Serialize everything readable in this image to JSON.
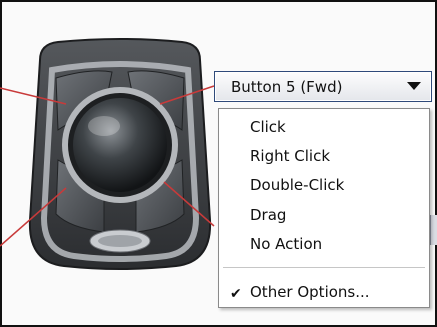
{
  "dropdown": {
    "selected": "Button 5 (Fwd)"
  },
  "menu": {
    "items": [
      "Click",
      "Right Click",
      "Double-Click",
      "Drag",
      "No Action"
    ],
    "other": "Other Options..."
  },
  "colors": {
    "callout_line": "#c83a3a",
    "dropdown_border": "#2f4a7a",
    "device_body": "#3b3d40",
    "device_trim": "#b9bcc1"
  },
  "icons": [
    "trackball-device-image",
    "dropdown-arrow-icon",
    "checkmark-icon"
  ]
}
